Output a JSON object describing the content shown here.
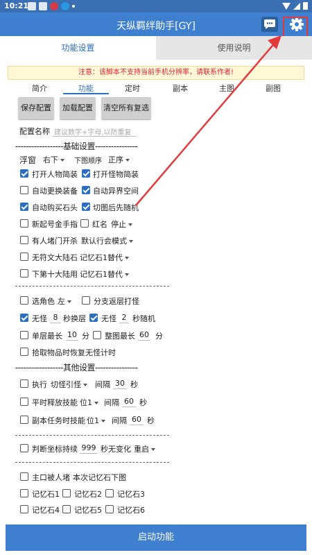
{
  "status": {
    "time": "10:21"
  },
  "header": {
    "title": "天纵羁绊助手[GY]"
  },
  "tabs": {
    "settings": "功能设置",
    "help": "使用说明"
  },
  "notice": "注意：该脚本不支持当前手机分辨率，请联系作者!",
  "subtabs": [
    "简介",
    "功能",
    "定时",
    "副本",
    "主图",
    "副图"
  ],
  "buttons": {
    "save": "保存配置",
    "load": "加载配置",
    "clear": "清空所有复选"
  },
  "config": {
    "label": "配置名称",
    "placeholder": "建议数字+字母,以防重复"
  },
  "sections": {
    "basic": "------------------基础设置----------------",
    "other": "------------------其他设置----------------"
  },
  "float": {
    "label": "浮窗",
    "value": "右下",
    "order_label": "下图顺序",
    "order_value": "正序"
  },
  "basic": {
    "open_person": "打开人物简装",
    "open_monster": "打开怪物简装",
    "auto_equip": "自动更换装备",
    "auto_otherworld": "自动异界空间",
    "auto_buy_stone": "自动购买石头",
    "switch_random": "切图后先随机",
    "new_gold_finger": "新起号金手指",
    "red_name": "红名",
    "red_name_value": "停止",
    "block_door": "有人堵门开杀",
    "block_door_value": "默认行会模式",
    "no_text_continent": "无符文大陆石",
    "no_text_continent_value": "记忆石1替代",
    "tenth_continent": "下第十大陆用",
    "tenth_continent_value": "记忆石1替代"
  },
  "combat": {
    "select_role": "选角色",
    "select_role_value": "左",
    "branch_back": "分支返层打怪",
    "no_monster1": "无怪",
    "no_monster1_value": "8",
    "no_monster1_unit": "秒换层",
    "no_monster2": "无怪",
    "no_monster2_value": "2",
    "no_monster2_unit": "秒随机",
    "single_max": "单层最长",
    "single_max_value": "10",
    "minute": "分",
    "whole_max": "整图最长",
    "whole_max_value": "60",
    "pickup": "拾取物品时恢复无怪计时"
  },
  "other": {
    "execute": "执行",
    "execute_value": "切怪引怪",
    "interval": "间隔",
    "execute_interval": "30",
    "sec": "秒",
    "normal_skill": "平时释放技能",
    "normal_skill_value": "位1",
    "normal_interval": "60",
    "dungeon_skill": "副本任务时技能",
    "dungeon_skill_value": "位1",
    "dungeon_interval": "60",
    "coord": "判断坐标持续",
    "coord_value": "999",
    "coord_unit": "秒无变化",
    "coord_action": "重启",
    "blocked": "主口被人堵",
    "blocked_hint": "本次记忆石下图",
    "stones": [
      "记忆石1",
      "记忆石2",
      "记忆石3",
      "记忆石4",
      "记忆石5",
      "记忆石6"
    ]
  },
  "start": "启动功能",
  "colors": {
    "primary": "#3f7fd0",
    "accent": "#2a6fc4",
    "alert": "#e23a3a"
  }
}
